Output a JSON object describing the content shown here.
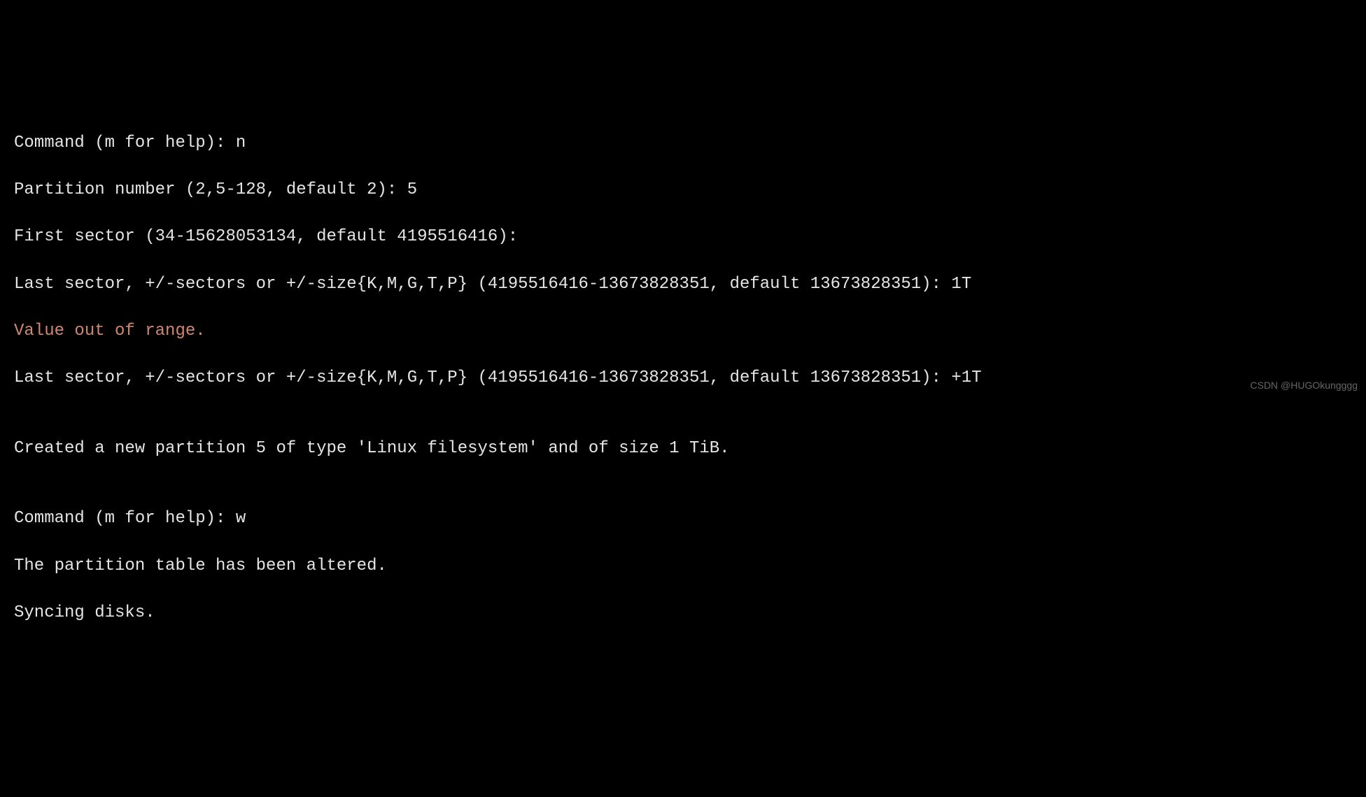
{
  "lines": {
    "l1_prompt": "Command (m for help): ",
    "l1_input": "n",
    "l2_prompt": "Partition number (2,5-128, default 2): ",
    "l2_input": "5",
    "l3_prompt": "First sector (34-15628053134, default 4195516416): ",
    "l3_input": "",
    "l4_prompt": "Last sector, +/-sectors or +/-size{K,M,G,T,P} (4195516416-13673828351, default 13673828351): ",
    "l4_input": "1T",
    "l5_error": "Value out of range.",
    "l6_prompt": "Last sector, +/-sectors or +/-size{K,M,G,T,P} (4195516416-13673828351, default 13673828351): ",
    "l6_input": "+1T",
    "l7_blank": "",
    "l8_msg": "Created a new partition 5 of type 'Linux filesystem' and of size 1 TiB.",
    "l9_blank": "",
    "l10_prompt": "Command (m for help): ",
    "l10_input": "w",
    "l11_msg": "The partition table has been altered.",
    "l12_msg": "Syncing disks."
  },
  "watermark": "CSDN @HUGOkungggg"
}
